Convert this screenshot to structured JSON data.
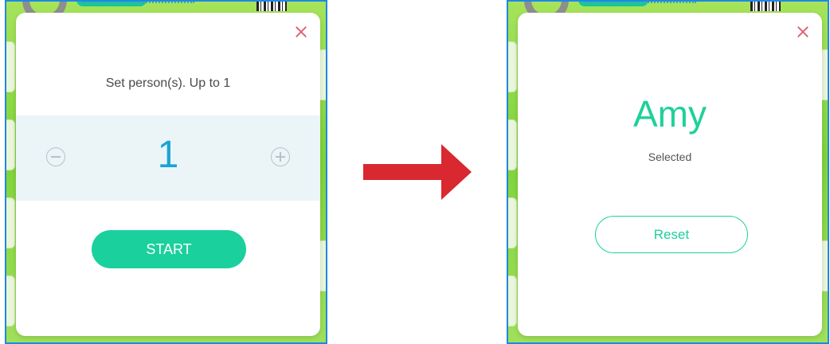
{
  "left_panel": {
    "dialog": {
      "title": "Set person(s). Up to 1",
      "count": "1",
      "start_label": "START"
    }
  },
  "right_panel": {
    "dialog": {
      "selected_name": "Amy",
      "selected_label": "Selected",
      "reset_label": "Reset"
    }
  },
  "colors": {
    "accent_green": "#1ad09c",
    "count_blue": "#1aa4d6",
    "close_red": "#e0607a",
    "arrow_red": "#d9282f",
    "frame_blue": "#1e88e5"
  },
  "icons": [
    "close-icon",
    "minus-circle-icon",
    "plus-circle-icon",
    "right-arrow-icon"
  ]
}
